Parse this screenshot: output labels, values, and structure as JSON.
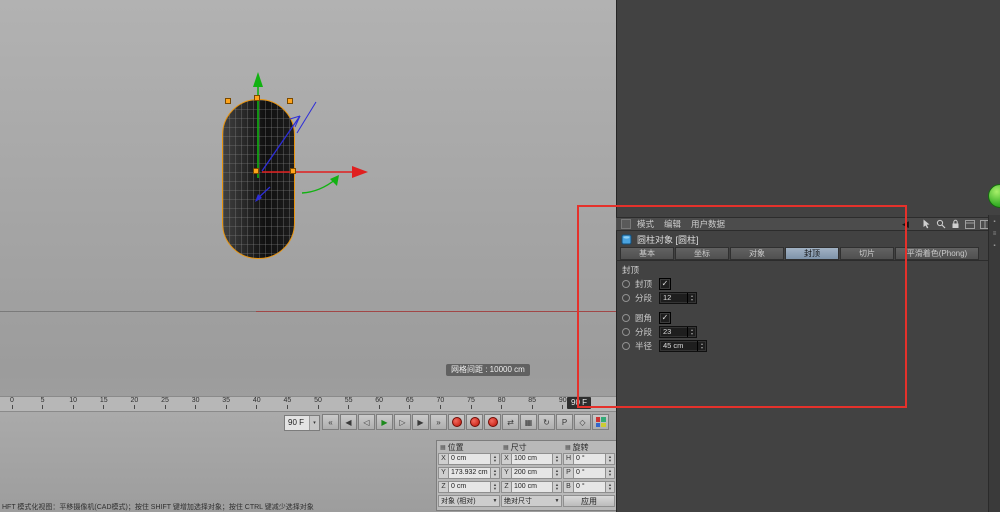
{
  "viewport": {
    "grid_label": "网格间距 : 10000 cm",
    "status_text": "HFT 模式化视图：平移摄像机(CAD模式)；按住 SHIFT 键增加选择对象；按住 CTRL 键减少选择对象"
  },
  "timeline": {
    "ticks": [
      0,
      5,
      10,
      15,
      20,
      25,
      30,
      35,
      40,
      45,
      50,
      55,
      60,
      65,
      70,
      75,
      80,
      85,
      90
    ],
    "current_frame_label": "90 F"
  },
  "transport": {
    "frame_field": "90 F",
    "buttons": [
      {
        "name": "goto-start-button",
        "glyph": "«"
      },
      {
        "name": "previous-key-button",
        "glyph": "◀"
      },
      {
        "name": "previous-frame-button",
        "glyph": "◁"
      },
      {
        "name": "play-button",
        "glyph": "▶",
        "accent": "play"
      },
      {
        "name": "next-frame-button",
        "glyph": "▷"
      },
      {
        "name": "next-key-button",
        "glyph": "▶"
      },
      {
        "name": "goto-end-button",
        "glyph": "»"
      },
      {
        "name": "record-keyframe-button",
        "accent": "record"
      },
      {
        "name": "autokeying-button",
        "accent": "record"
      },
      {
        "name": "keyframe-selection-button",
        "accent": "record"
      },
      {
        "name": "record-position-toggle",
        "glyph": "⇄"
      },
      {
        "name": "record-scale-toggle",
        "glyph": "▦"
      },
      {
        "name": "record-rotation-toggle",
        "glyph": "↻"
      },
      {
        "name": "record-parameter-toggle",
        "glyph": "P"
      },
      {
        "name": "record-pla-toggle",
        "glyph": "◇"
      },
      {
        "name": "content-browser-button",
        "accent": "color"
      }
    ]
  },
  "coordinates": {
    "columns": [
      {
        "header": "位置",
        "rows": [
          {
            "label": "X",
            "value": "0 cm"
          },
          {
            "label": "Y",
            "value": "173.932 cm"
          },
          {
            "label": "Z",
            "value": "0 cm"
          }
        ],
        "footer": {
          "type": "dropdown",
          "label": "对象 (相对)",
          "name": "coordinate-mode-dropdown"
        }
      },
      {
        "header": "尺寸",
        "rows": [
          {
            "label": "X",
            "value": "100 cm"
          },
          {
            "label": "Y",
            "value": "200 cm"
          },
          {
            "label": "Z",
            "value": "100 cm"
          }
        ],
        "footer": {
          "type": "dropdown",
          "label": "绝对尺寸",
          "name": "size-mode-dropdown"
        }
      },
      {
        "header": "旋转",
        "rows": [
          {
            "label": "H",
            "value": "0 °"
          },
          {
            "label": "P",
            "value": "0 °"
          },
          {
            "label": "B",
            "value": "0 °"
          }
        ],
        "footer": {
          "type": "button",
          "label": "应用",
          "name": "apply-button"
        }
      }
    ]
  },
  "attributes": {
    "menu": [
      {
        "name": "menu-mode",
        "label": "模式"
      },
      {
        "name": "menu-edit",
        "label": "编辑"
      },
      {
        "name": "menu-user-data",
        "label": "用户数据"
      }
    ],
    "title": "圆柱对象 [圆柱]",
    "tabs": [
      {
        "name": "tab-basic",
        "label": "基本",
        "active": false
      },
      {
        "name": "tab-coordinates",
        "label": "坐标",
        "active": false
      },
      {
        "name": "tab-object",
        "label": "对象",
        "active": false
      },
      {
        "name": "tab-caps",
        "label": "封顶",
        "active": true
      },
      {
        "name": "tab-slice",
        "label": "切片",
        "active": false
      },
      {
        "name": "tab-phong",
        "label": "平滑着色(Phong)",
        "active": false
      }
    ],
    "section": "封顶",
    "params": [
      {
        "name": "caps-checkbox",
        "label": "封顶",
        "type": "checkbox",
        "checked": true
      },
      {
        "name": "cap-segments-field",
        "label": "分段",
        "type": "field",
        "value": "12"
      },
      {
        "name": "fillet-checkbox",
        "label": "圆角",
        "type": "checkbox",
        "checked": true
      },
      {
        "name": "fillet-segments-field",
        "label": "分段",
        "type": "field",
        "value": "23"
      },
      {
        "name": "fillet-radius-field",
        "label": "半径",
        "type": "field",
        "value": "45 cm"
      }
    ]
  },
  "colors": {
    "selection_orange": "#e8940f",
    "axis_x_red": "#e01f1f",
    "axis_y_green": "#12b212",
    "axis_z_blue": "#2d2dd8",
    "annotation_red": "#e5312b",
    "active_tab": "#8ea4ba",
    "sphere_green": "#3db32a"
  }
}
